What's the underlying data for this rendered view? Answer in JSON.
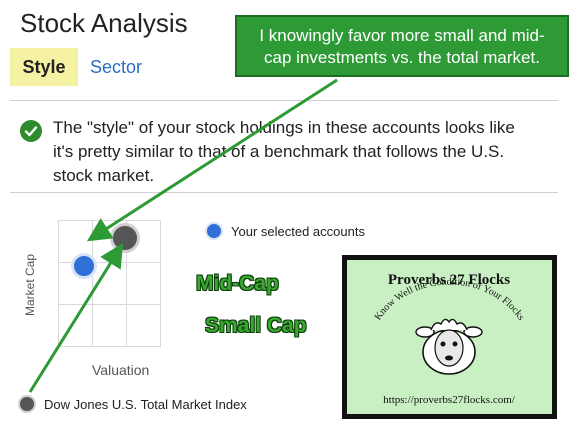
{
  "header": {
    "title": "Stock Analysis"
  },
  "tabs": [
    {
      "label": "Style",
      "active": true
    },
    {
      "label": "Sector",
      "active": false
    }
  ],
  "summary": {
    "lines": [
      "The \"style\" of your stock holdings in these accounts looks like",
      "it's pretty similar to that of a benchmark that follows the U.S.",
      "stock market."
    ],
    "icon": "check-icon"
  },
  "style_box": {
    "y_axis_label": "Market Cap",
    "x_axis_label": "Valuation"
  },
  "legend": {
    "selected_accounts": {
      "label": "Your selected accounts",
      "color": "#2f6fd6"
    },
    "benchmark": {
      "label": "Dow Jones U.S. Total Market Index",
      "color": "#555555"
    }
  },
  "annotation": {
    "lines": [
      "I knowingly favor more small and mid-",
      "cap investments vs. the total market."
    ],
    "bg_color": "#2e9a35"
  },
  "overlay_labels": {
    "mid_cap": "Mid-Cap",
    "small_cap": "Small Cap"
  },
  "logo": {
    "title": "Proverbs 27 Flocks",
    "arc_text": "Know Well the Condition of Your Flocks",
    "url": "https://proverbs27flocks.com/"
  }
}
